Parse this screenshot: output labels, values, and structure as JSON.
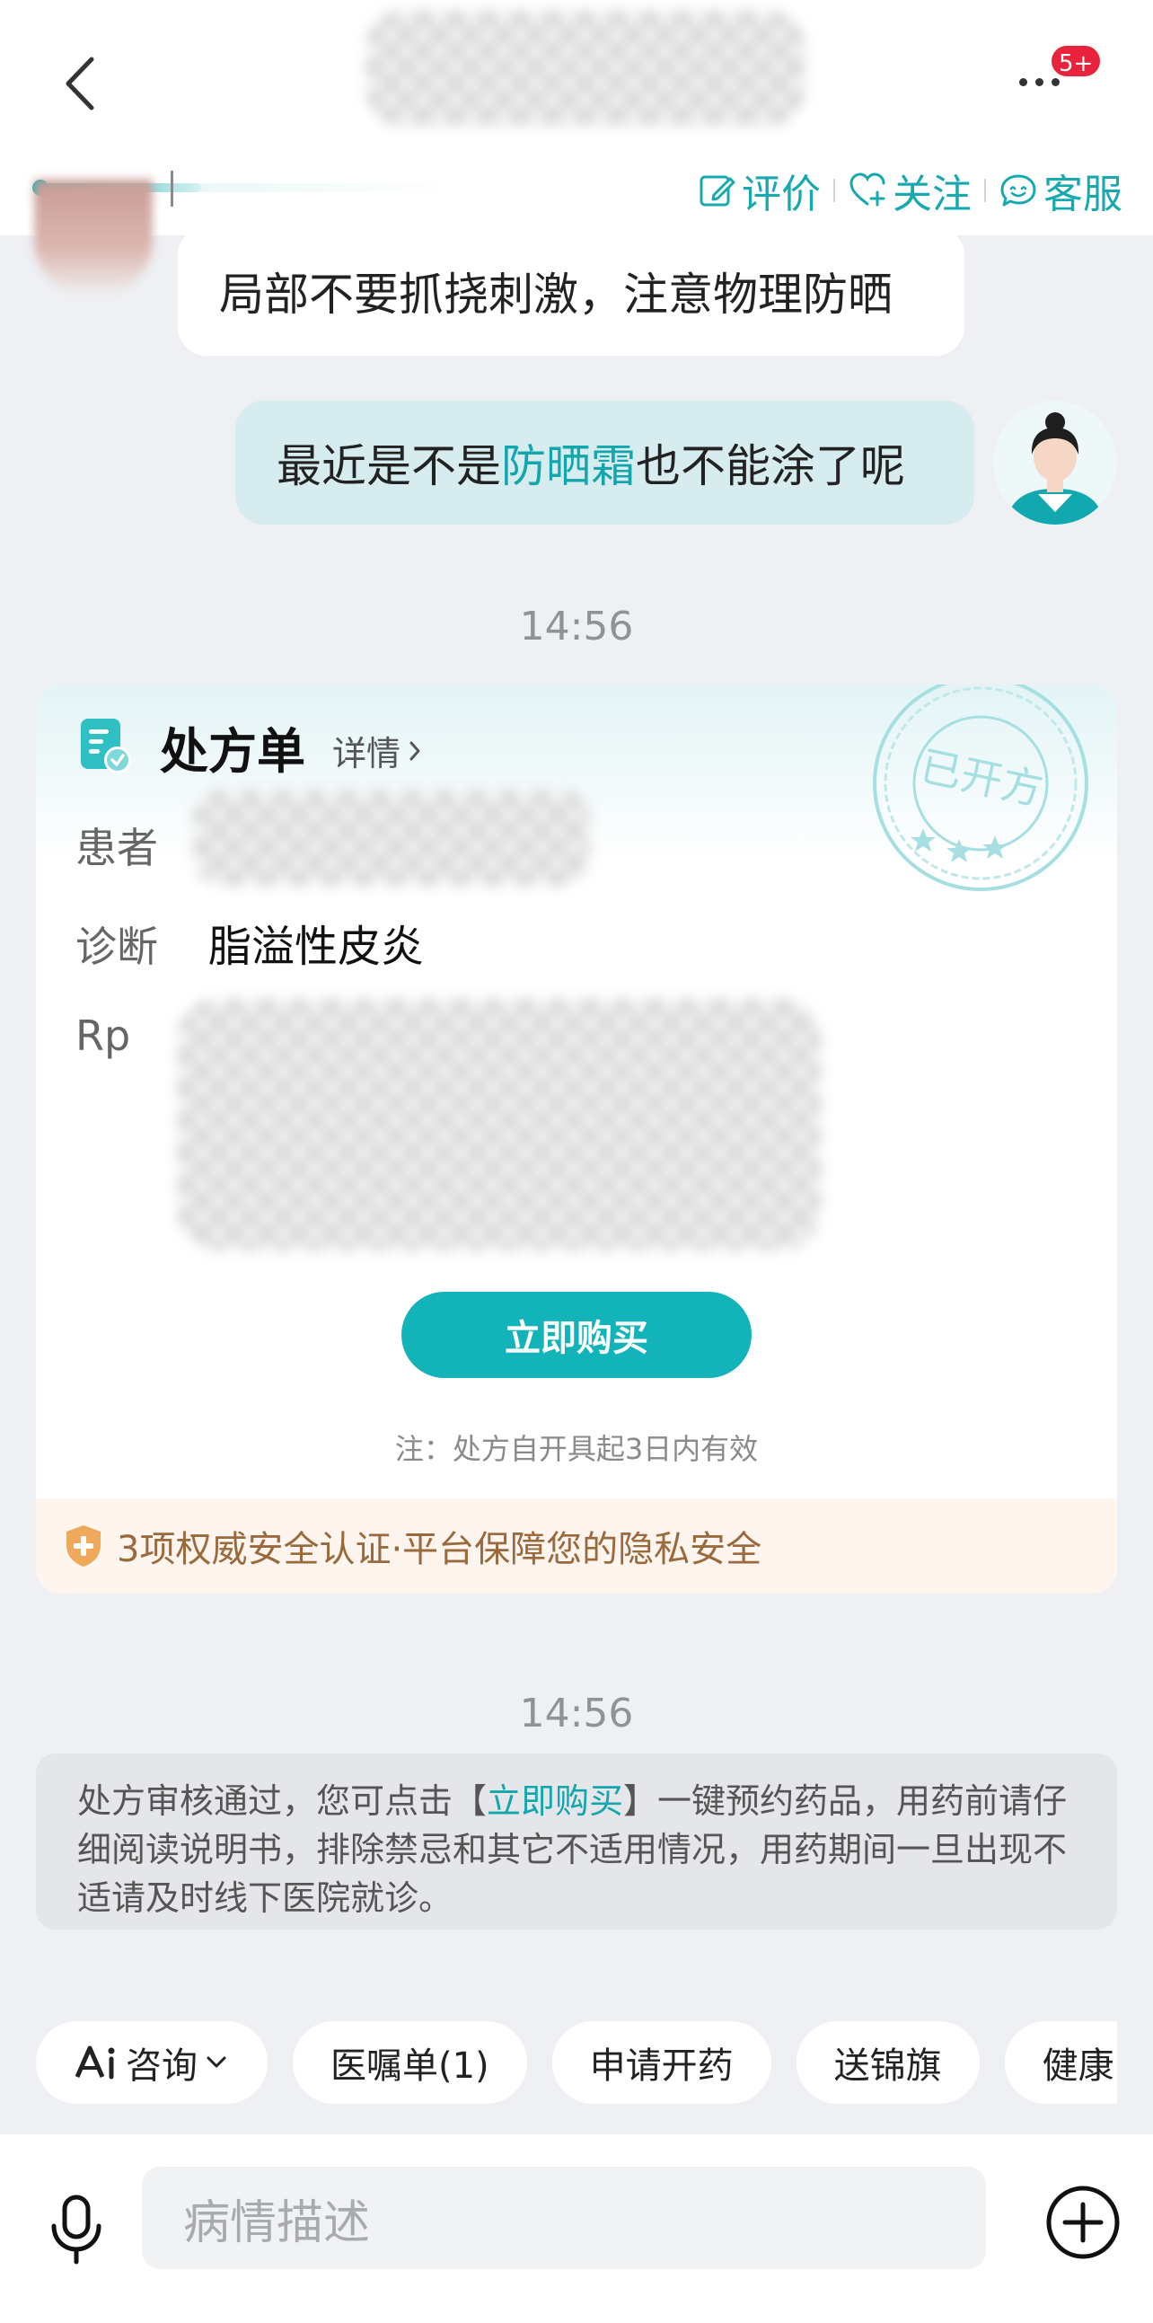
{
  "header": {
    "badge": "5+",
    "actions": {
      "review": "评价",
      "follow": "关注",
      "service": "客服"
    }
  },
  "chat": {
    "doctor_message": "局部不要抓挠刺激，注意物理防晒",
    "user_message": {
      "before": "最近是不是",
      "highlight": "防晒霜",
      "after": "也不能涂了呢"
    },
    "timestamp_1": "14:56",
    "timestamp_2": "14:56"
  },
  "prescription": {
    "title": "处方单",
    "detail_label": "详情",
    "stamp_text": "已开方",
    "patient_label": "患者",
    "diagnosis_label": "诊断",
    "diagnosis_value": "脂溢性皮炎",
    "rp_label": "Rp",
    "buy_button": "立即购买",
    "note": "注：处方自开具起3日内有效",
    "security_text": "3项权威安全认证·平台保障您的隐私安全"
  },
  "notice": {
    "before": "处方审核通过，您可点击【",
    "link": "立即购买",
    "after": "】一键预约药品，用药前请仔细阅读说明书，排除禁忌和其它不适用情况，用药期间一旦出现不适请及时线下医院就诊。"
  },
  "chips": {
    "ai_consult": "咨询",
    "advice": "医嘱单(1)",
    "apply_rx": "申请开药",
    "banner": "送锦旗",
    "health": "健康"
  },
  "input": {
    "placeholder": "病情描述"
  },
  "colors": {
    "accent": "#12b4b9",
    "badge": "#e8233b",
    "bubble_user": "#d6ecef",
    "security": "#9a6a3c"
  }
}
